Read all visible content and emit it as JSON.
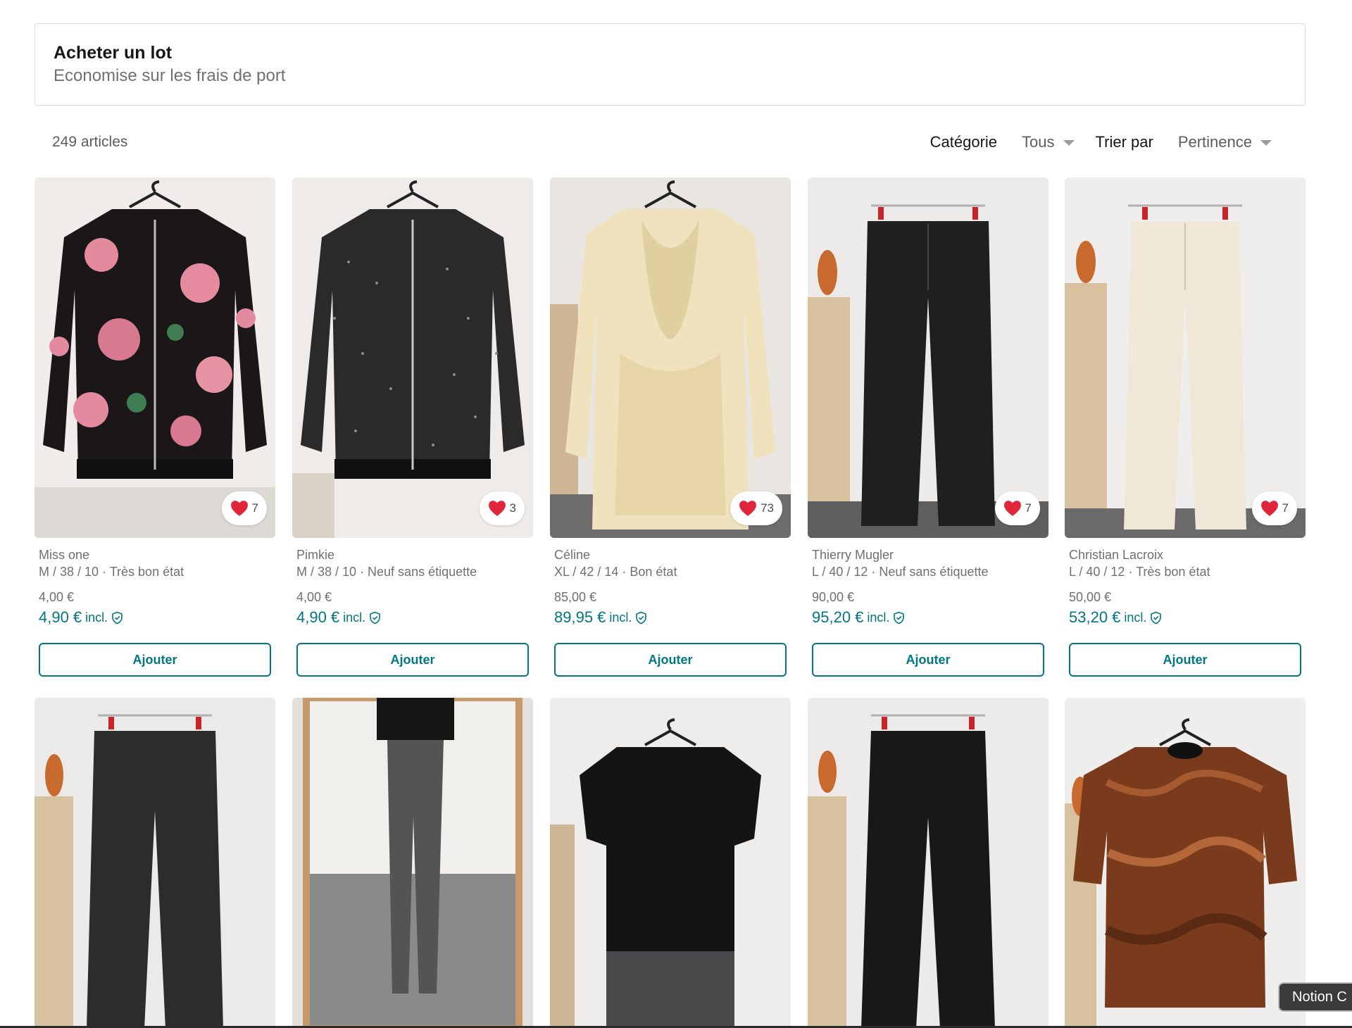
{
  "bundle": {
    "title": "Acheter un lot",
    "subtitle": "Economise sur les frais de port"
  },
  "toolbar": {
    "count": "249 articles",
    "category_label": "Catégorie",
    "category_value": "Tous",
    "sort_label": "Trier par",
    "sort_value": "Pertinence"
  },
  "labels": {
    "incl": "incl.",
    "add": "Ajouter"
  },
  "colors": {
    "accent": "#007782",
    "heart": "#e0263b"
  },
  "items": [
    {
      "brand": "Miss one",
      "details": "M / 38 / 10 · Très bon état",
      "price": "4,00 €",
      "price_incl": "4,90 €",
      "favorites": "7"
    },
    {
      "brand": "Pimkie",
      "details": "M / 38 / 10 · Neuf sans étiquette",
      "price": "4,00 €",
      "price_incl": "4,90 €",
      "favorites": "3"
    },
    {
      "brand": "Céline",
      "details": "XL / 42 / 14 · Bon état",
      "price": "85,00 €",
      "price_incl": "89,95 €",
      "favorites": "73"
    },
    {
      "brand": "Thierry Mugler",
      "details": "L / 40 / 12 · Neuf sans étiquette",
      "price": "90,00 €",
      "price_incl": "95,20 €",
      "favorites": "7"
    },
    {
      "brand": "Christian Lacroix",
      "details": "L / 40 / 12 · Très bon état",
      "price": "50,00 €",
      "price_incl": "53,20 €",
      "favorites": "7"
    }
  ],
  "overlay": {
    "notion_label": "Notion C"
  }
}
